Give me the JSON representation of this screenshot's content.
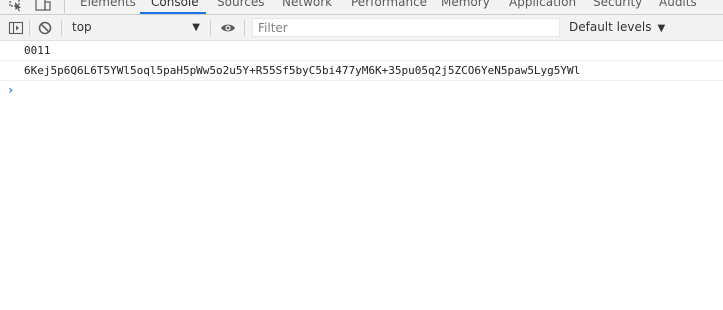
{
  "tabs": [
    {
      "label": "Elements"
    },
    {
      "label": "Console"
    },
    {
      "label": "Sources"
    },
    {
      "label": "Network"
    },
    {
      "label": "Performance"
    },
    {
      "label": "Memory"
    },
    {
      "label": "Application"
    },
    {
      "label": "Security"
    },
    {
      "label": "Audits"
    }
  ],
  "toolbar": {
    "context": "top",
    "filter_placeholder": "Filter",
    "levels_label": "Default levels",
    "caret": "▼"
  },
  "console": {
    "messages": [
      {
        "text": "0011"
      },
      {
        "text": "6Kej5p6Q6L6T5YWl5oql5paH5pWw5o2u5Y+R55Sf5byC5bi477yM6K+35pu05q2j5ZCO6YeN5paw5Lyg5YWl"
      }
    ],
    "prompt": "›"
  },
  "colors": {
    "accent": "#1a73e8",
    "toolbar_bg": "#f3f3f3"
  }
}
